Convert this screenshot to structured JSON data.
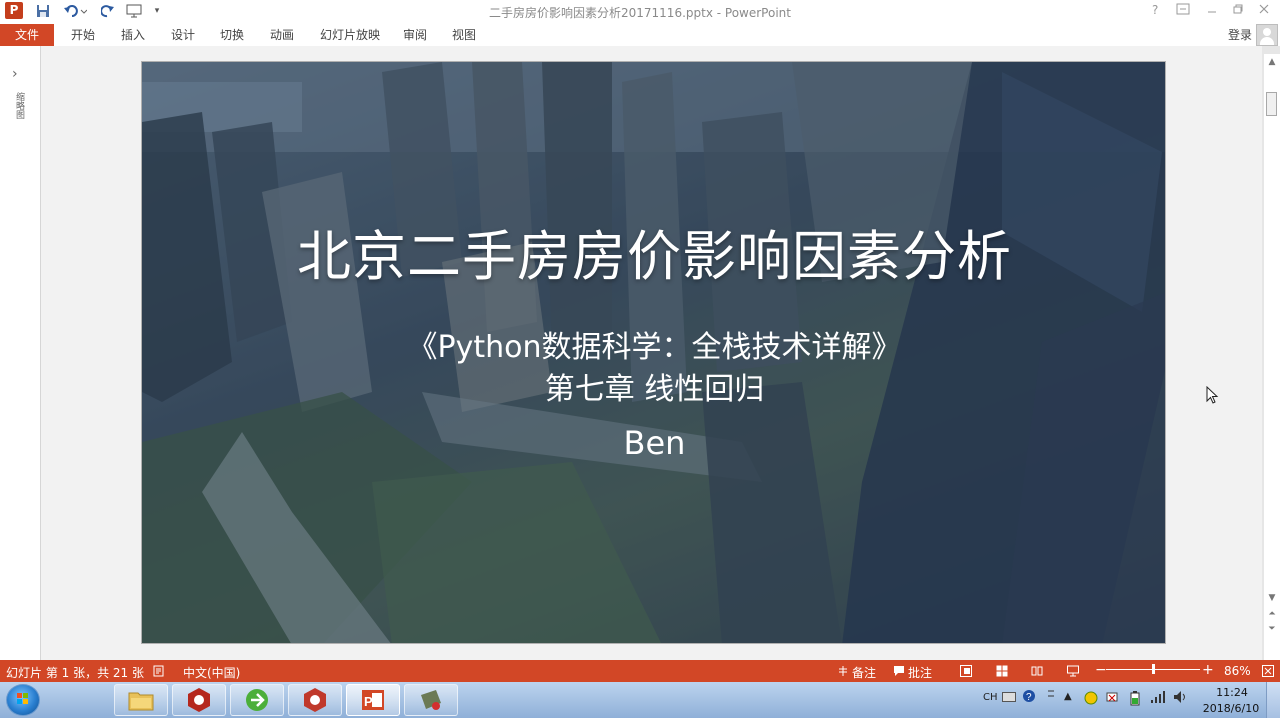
{
  "window": {
    "title": "二手房房价影响因素分析20171116.pptx - PowerPoint",
    "help": "?"
  },
  "ribbon": {
    "tabs": [
      "文件",
      "开始",
      "插入",
      "设计",
      "切换",
      "动画",
      "幻灯片放映",
      "审阅",
      "视图"
    ],
    "login": "登录"
  },
  "thumbnail_pane": {
    "label": "缩略图"
  },
  "slide": {
    "title": "北京二手房房价影响因素分析",
    "subtitle_line1": "《Python数据科学：全栈技术详解》",
    "subtitle_line2": "第七章 线性回归",
    "author": "Ben"
  },
  "statusbar": {
    "slide_info": "幻灯片 第 1 张，共 21 张",
    "language": "中文(中国)",
    "notes": "备注",
    "comments": "批注",
    "zoom": "86%",
    "zoom_fraction": 0.5
  },
  "taskbar": {
    "apps": [
      "file-explorer",
      "app-red-1",
      "app-green",
      "app-red-2",
      "powerpoint",
      "app-misc"
    ],
    "active_app": "powerpoint",
    "tray_lang": "CH",
    "time": "11:24",
    "date": "2018/6/10"
  },
  "colors": {
    "accent": "#d24726",
    "taskbar": "#a9c4e6",
    "slide_text": "#ffffff"
  }
}
